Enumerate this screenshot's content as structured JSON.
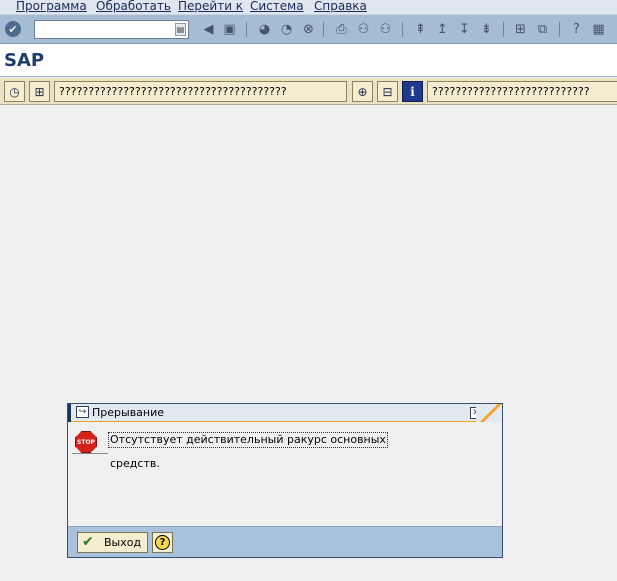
{
  "menu": {
    "items": [
      {
        "label": "Программа"
      },
      {
        "label": "Обработать"
      },
      {
        "label": "Перейти к"
      },
      {
        "label": "Система"
      },
      {
        "label": "Справка"
      }
    ]
  },
  "system_toolbar": {
    "command_field": {
      "value": "",
      "placeholder": ""
    },
    "icons": [
      "enter-icon",
      "back-icon",
      "save-icon",
      "back-nav-icon",
      "exit-icon",
      "cancel-icon",
      "print-icon",
      "find-icon",
      "find-next-icon",
      "first-page-icon",
      "previous-page-icon",
      "next-page-icon",
      "last-page-icon",
      "create-session-icon",
      "shortcut-icon",
      "help-icon",
      "layout-menu-icon"
    ]
  },
  "title": {
    "text": "SAP"
  },
  "app_toolbar": {
    "button1_label": "???????????????????????????????????????",
    "button2_label": "???????????????????????????"
  },
  "dialog": {
    "title": "Прерывание",
    "message_line1": "Отсутствует действительный ракурс основных",
    "message_line2": "средств.",
    "stop_icon_text": "STOP",
    "exit_button_label": "Выход",
    "colors": {
      "stop": "#d6201a",
      "title_accent": "#f5a321",
      "footer": "#a8c1dd"
    }
  }
}
